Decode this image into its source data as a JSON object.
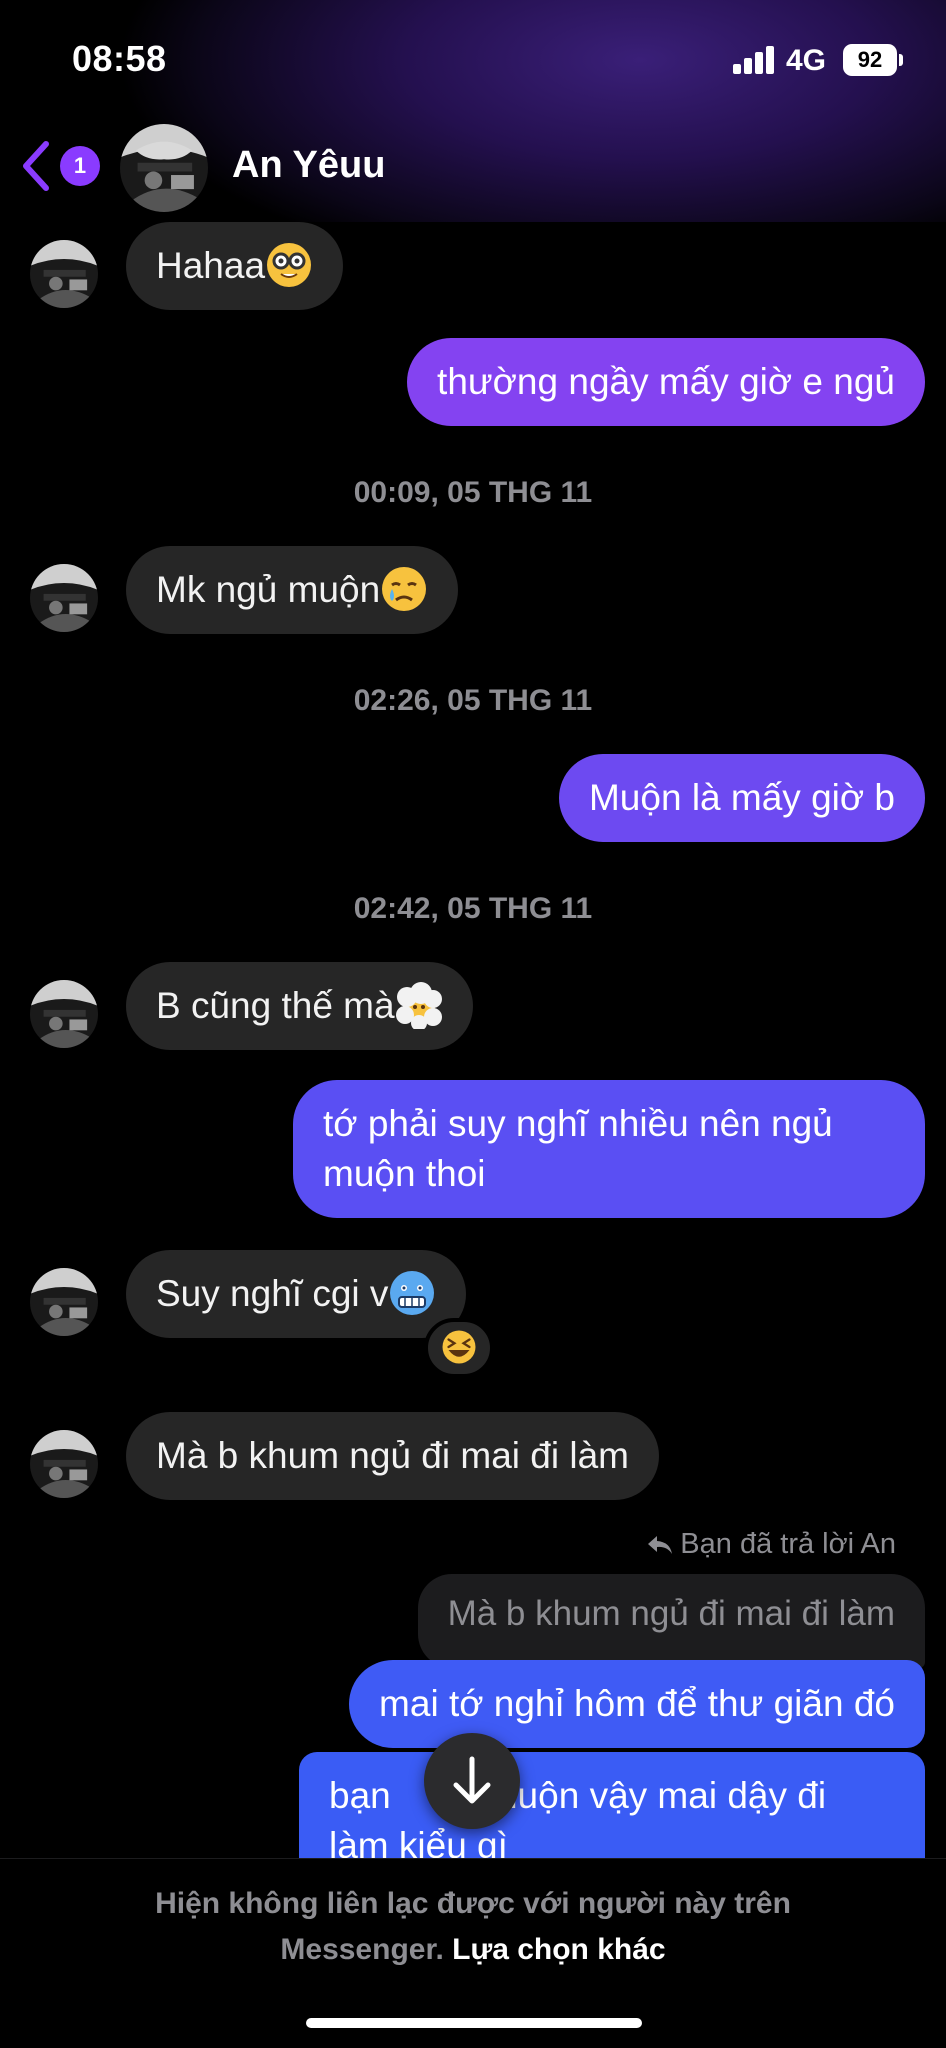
{
  "status_bar": {
    "time": "08:58",
    "network": "4G",
    "battery": "92"
  },
  "header": {
    "unread_count": "1",
    "contact_name": "An Yêuu"
  },
  "messages": {
    "m1": {
      "text": "Hahaa",
      "emoji": "nerd-face"
    },
    "m2": {
      "text": "thường ngầy mấy giờ e ngủ"
    },
    "ts1": "00:09, 05 THG 11",
    "m3": {
      "text": "Mk ngủ muộn",
      "emoji": "crying-face"
    },
    "ts2": "02:26, 05 THG 11",
    "m4": {
      "text": "Muộn là mấy giờ b"
    },
    "ts3": "02:42, 05 THG 11",
    "m5": {
      "text": "B cũng thế mà",
      "emoji": "face-in-clouds"
    },
    "m6": {
      "line1": "tớ phải suy nghĩ nhiều nên ngủ",
      "line2": "muộn thoi"
    },
    "m7": {
      "text": "Suy nghĩ cgi v",
      "emoji": "cold-face",
      "reaction": "grinning-squinting-face"
    },
    "m8": {
      "text": "Mà b khum ngủ đi mai đi làm"
    },
    "reply_note": "Bạn đã trả lời An",
    "quoted": "Mà b khum ngủ đi mai đi làm",
    "m9": {
      "text": "mai tớ nghỉ hôm để thư giãn đó"
    },
    "m10": {
      "part1": "bạn",
      "part2": "muộn vậy mai dậy đi",
      "line2": "làm kiểu gì"
    }
  },
  "footer": {
    "notice_line1": "Hiện không liên lạc được với người này trên",
    "notice_line2": "Messenger.",
    "option": "Lựa chọn khác"
  },
  "colors": {
    "outgoing_top": "#8a44f2",
    "outgoing_bottom": "#3b5cf5",
    "incoming": "#262626",
    "accent": "#8a3bff"
  }
}
